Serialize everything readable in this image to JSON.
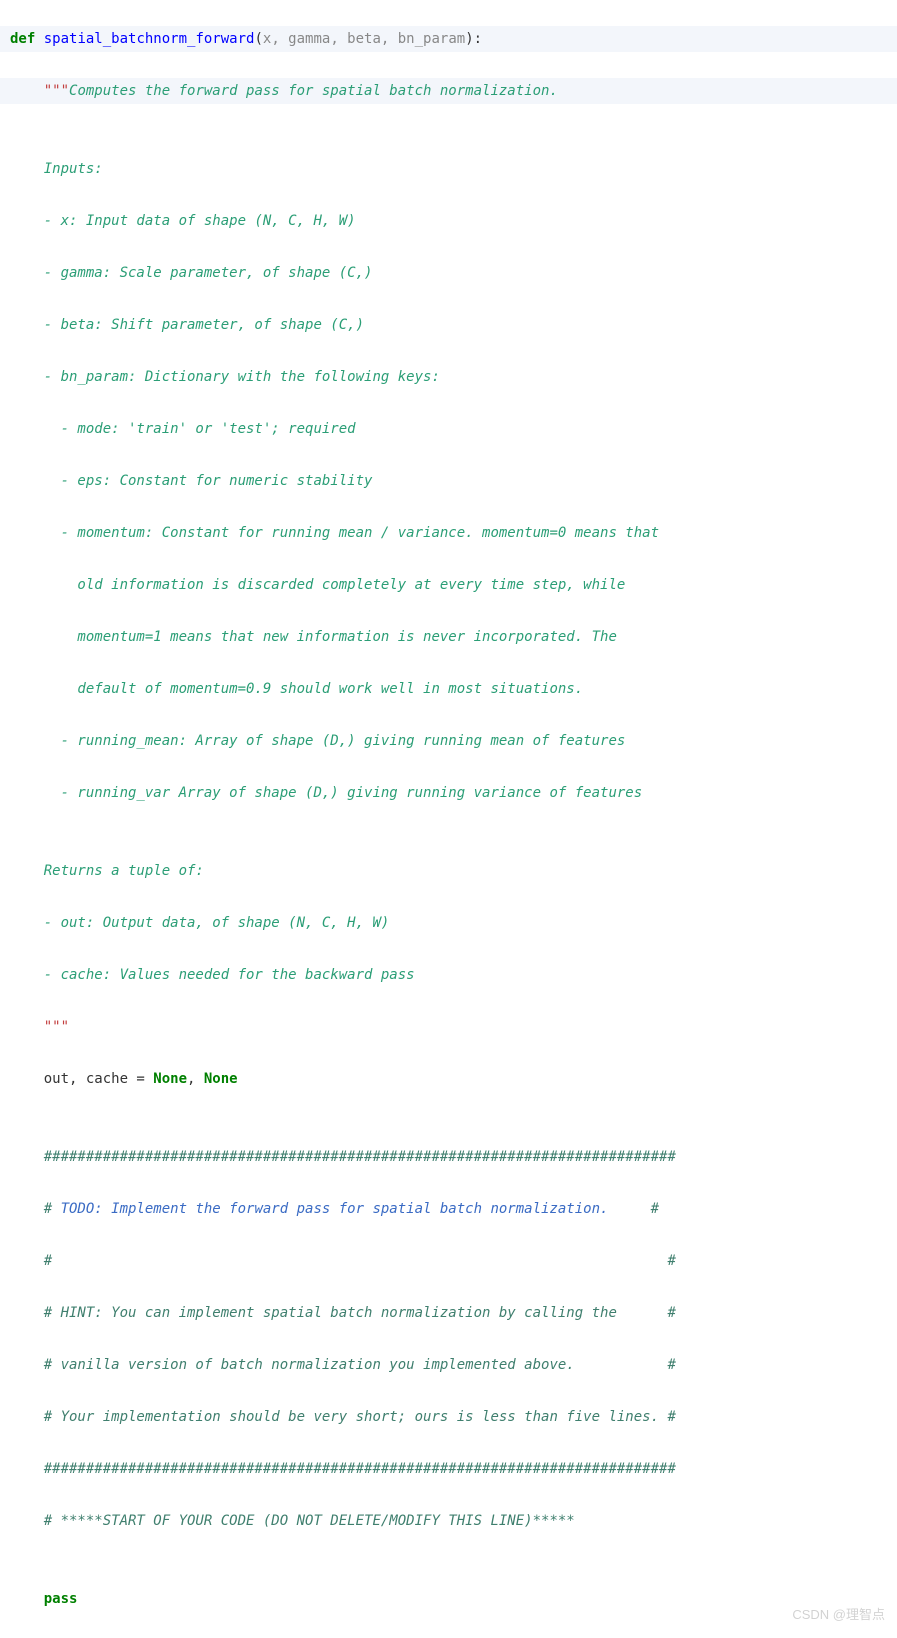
{
  "def_kw": "def",
  "fn_name": "spatial_batchnorm_forward",
  "open_paren": "(",
  "params": "x, gamma, beta, bn_param",
  "close_paren_colon": "):",
  "indent": "    ",
  "docq": "\"\"\"",
  "doc01": "Computes the forward pass for spatial batch normalization.",
  "blank": "",
  "doc02": "Inputs:",
  "doc03": "- x: Input data of shape (N, C, H, W)",
  "doc04": "- gamma: Scale parameter, of shape (C,)",
  "doc05": "- beta: Shift parameter, of shape (C,)",
  "doc06": "- bn_param: Dictionary with the following keys:",
  "doc07": "  - mode: 'train' or 'test'; required",
  "doc08": "  - eps: Constant for numeric stability",
  "doc09": "  - momentum: Constant for running mean / variance. momentum=0 means that",
  "doc10": "    old information is discarded completely at every time step, while",
  "doc11": "    momentum=1 means that new information is never incorporated. The",
  "doc12": "    default of momentum=0.9 should work well in most situations.",
  "doc13": "  - running_mean: Array of shape (D,) giving running mean of features",
  "doc14": "  - running_var Array of shape (D,) giving running variance of features",
  "doc15": "Returns a tuple of:",
  "doc16": "- out: Output data, of shape (N, C, H, W)",
  "doc17": "- cache: Values needed for the backward pass",
  "code_out_l": "out, cache = ",
  "none1": "None",
  "comma_sp": ", ",
  "none2": "None",
  "hash_bar": "###########################################################################",
  "c_todo_pre": "# ",
  "c_todo_txt": "TODO: Implement the forward pass for spatial batch normalization.",
  "c_todo_pad": "     #",
  "c_empty": "#                                                                         #",
  "c_hint1": "# HINT: You can implement spatial batch normalization by calling the      #",
  "c_hint2": "# vanilla version of batch normalization you implemented above.           #",
  "c_hint3": "# Your implementation should be very short; ours is less than five lines. #",
  "c_start": "# *****START OF YOUR CODE (DO NOT DELETE/MODIFY THIS LINE)*****",
  "pass_kw": "pass",
  "watermark": "CSDN @理智点"
}
